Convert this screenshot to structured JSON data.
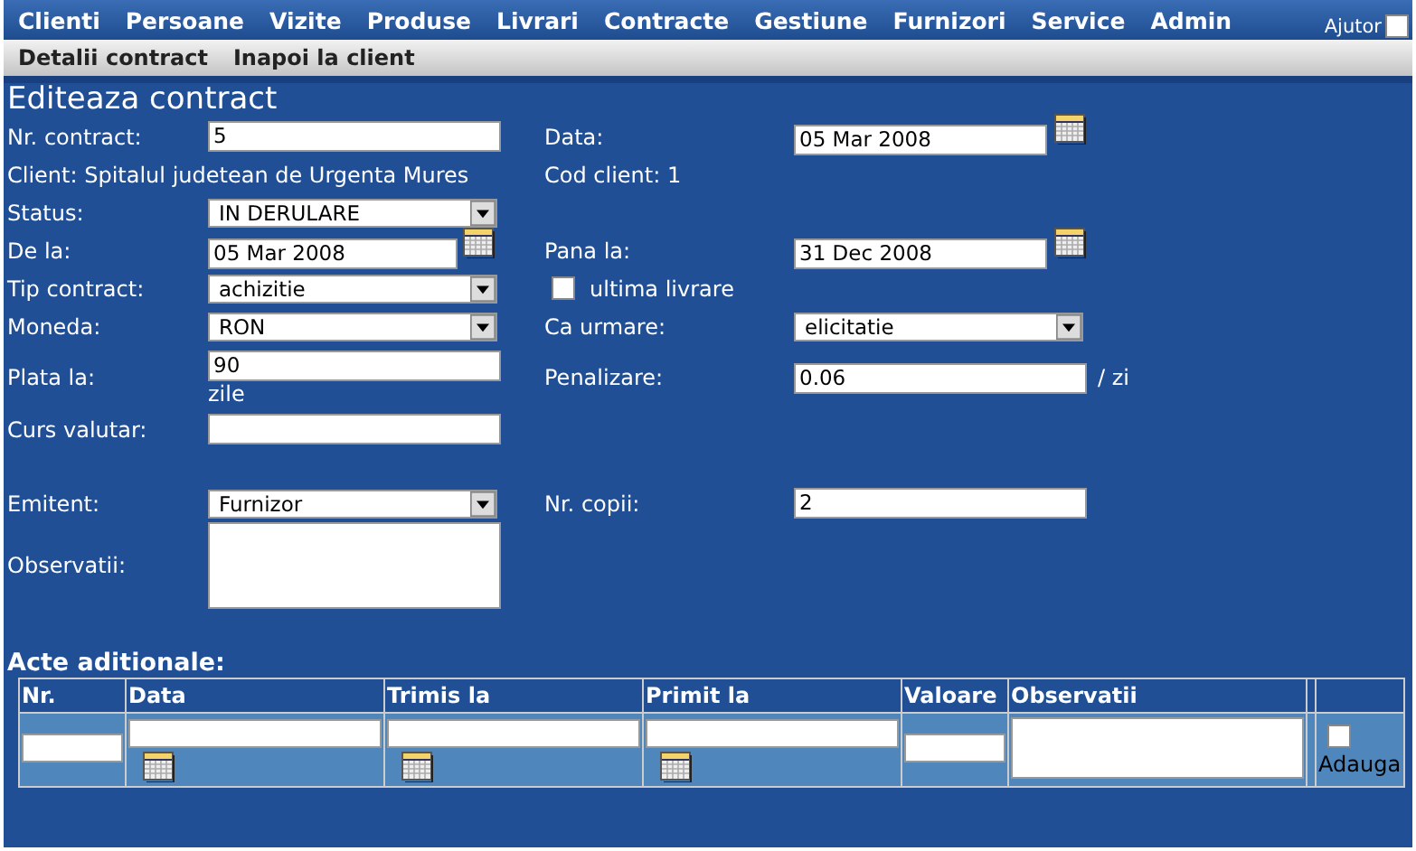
{
  "menu": {
    "items": [
      "Clienti",
      "Persoane",
      "Vizite",
      "Produse",
      "Livrari",
      "Contracte",
      "Gestiune",
      "Furnizori",
      "Service",
      "Admin"
    ],
    "help": {
      "label": "Ajutor",
      "checked": false
    }
  },
  "subnav": [
    "Detalii contract",
    "Inapoi la client"
  ],
  "title": "Editeaza contract",
  "rows": [
    {
      "left": {
        "kind": "text",
        "label": "Nr. contract:",
        "value": "5"
      },
      "right": {
        "kind": "date",
        "label": "Data:",
        "value": "05 Mar 2008"
      }
    },
    {
      "left": {
        "kind": "static",
        "text": "Client: Spitalul judetean de Urgenta Mures"
      },
      "right": {
        "kind": "static",
        "text": "Cod client: 1"
      }
    },
    {
      "left": {
        "kind": "select",
        "label": "Status:",
        "value": "IN DERULARE"
      }
    },
    {
      "left": {
        "kind": "date",
        "label": "De la:",
        "value": "05 Mar 2008"
      },
      "right": {
        "kind": "date",
        "label": "Pana la:",
        "value": "31 Dec 2008"
      }
    },
    {
      "left": {
        "kind": "select",
        "label": "Tip contract:",
        "value": "achizitie"
      },
      "right": {
        "kind": "checkbox",
        "label": "ultima livrare",
        "checked": false
      }
    },
    {
      "left": {
        "kind": "select",
        "label": "Moneda:",
        "value": "RON"
      },
      "right": {
        "kind": "select",
        "label": "Ca urmare:",
        "value": "elicitatie"
      }
    },
    {
      "left": {
        "kind": "text",
        "label": "Plata la:",
        "value": "90",
        "unit": "zile"
      },
      "right": {
        "kind": "text",
        "label": "Penalizare:",
        "value": "0.06",
        "unit": "/ zi"
      }
    },
    {
      "left": {
        "kind": "text",
        "label": "Curs valutar:"
      }
    },
    {
      "left": {
        "kind": "select",
        "label": "Emitent:",
        "value": "Furnizor"
      },
      "right": {
        "kind": "text",
        "label": "Nr. copii:",
        "value": "2"
      }
    },
    {
      "left": {
        "kind": "textarea",
        "label": "Observatii:"
      }
    }
  ],
  "additional": {
    "title": "Acte aditionale:",
    "columns": [
      "Nr.",
      "Data",
      "Trimis la",
      "Primit la",
      "Valoare",
      "Observatii"
    ],
    "new_row": [
      {
        "kind": "text"
      },
      {
        "kind": "date"
      },
      {
        "kind": "date"
      },
      {
        "kind": "date"
      },
      {
        "kind": "text"
      },
      {
        "kind": "textarea"
      },
      {
        "kind": "blank"
      },
      {
        "kind": "checkbox",
        "label": "Adauga",
        "checked": false
      }
    ]
  }
}
